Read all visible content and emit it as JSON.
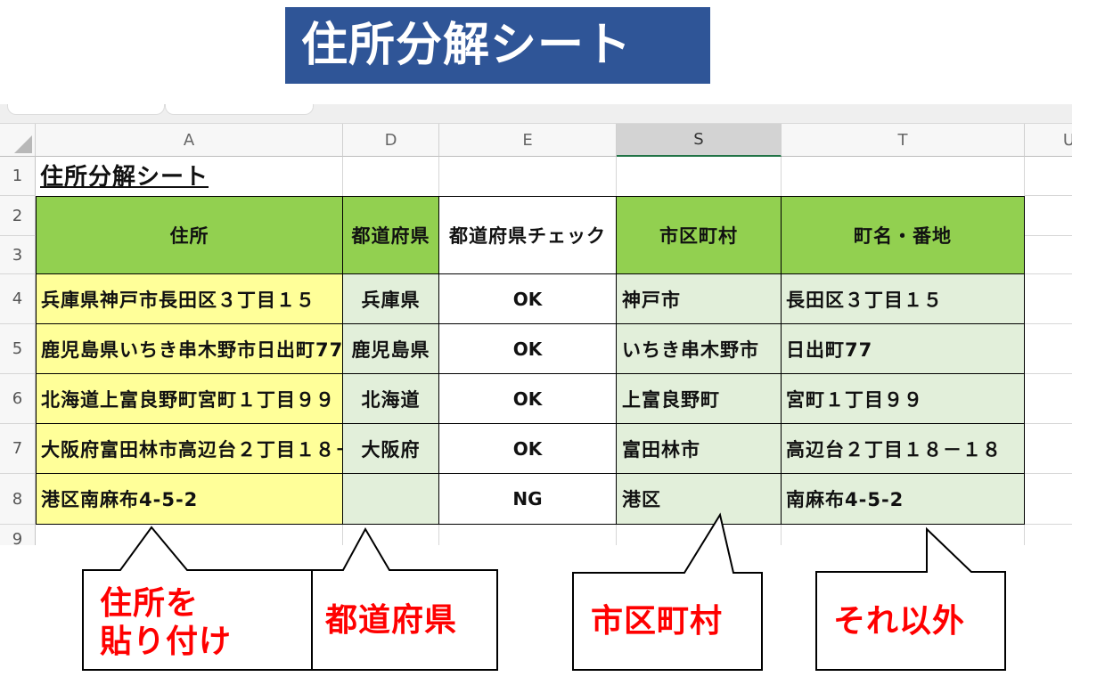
{
  "banner": {
    "title": "住所分解シート"
  },
  "sheet": {
    "columns": [
      {
        "label": "A"
      },
      {
        "label": "D"
      },
      {
        "label": "E"
      },
      {
        "label": "S",
        "selected": true
      },
      {
        "label": "T"
      },
      {
        "label": "U"
      }
    ],
    "row_numbers": [
      "1",
      "2",
      "3",
      "4",
      "5",
      "6",
      "7",
      "8",
      "9"
    ],
    "title_cell": "住所分解シート",
    "headers": {
      "address": "住所",
      "prefecture": "都道府県",
      "prefecture_check": "都道府県チェック",
      "city": "市区町村",
      "town": "町名・番地"
    },
    "rows": [
      {
        "address": "兵庫県神戸市長田区３丁目１５",
        "prefecture": "兵庫県",
        "check": "OK",
        "city": "神戸市",
        "town": "長田区３丁目１５"
      },
      {
        "address": "鹿児島県いちき串木野市日出町77",
        "prefecture": "鹿児島県",
        "check": "OK",
        "city": "いちき串木野市",
        "town": "日出町77"
      },
      {
        "address": "北海道上富良野町宮町１丁目９９",
        "prefecture": "北海道",
        "check": "OK",
        "city": "上富良野町",
        "town": "宮町１丁目９９"
      },
      {
        "address": "大阪府富田林市高辺台２丁目１８－",
        "prefecture": "大阪府",
        "check": "OK",
        "city": "富田林市",
        "town": "高辺台２丁目１８－１８"
      },
      {
        "address": "港区南麻布4-5-2",
        "prefecture": "",
        "check": "NG",
        "city": "港区",
        "town": "南麻布4-5-2"
      }
    ]
  },
  "callouts": [
    {
      "lines": [
        "住所を",
        "貼り付け"
      ]
    },
    {
      "lines": [
        "都道府県"
      ]
    },
    {
      "lines": [
        "市区町村"
      ]
    },
    {
      "lines": [
        "それ以外"
      ]
    }
  ],
  "colors": {
    "banner": "#2f5597",
    "header_green": "#92d050",
    "input_yellow": "#ffff99",
    "output_green": "#e2efda",
    "callout_text": "#ff0000",
    "selected_column_accent": "#217346"
  }
}
